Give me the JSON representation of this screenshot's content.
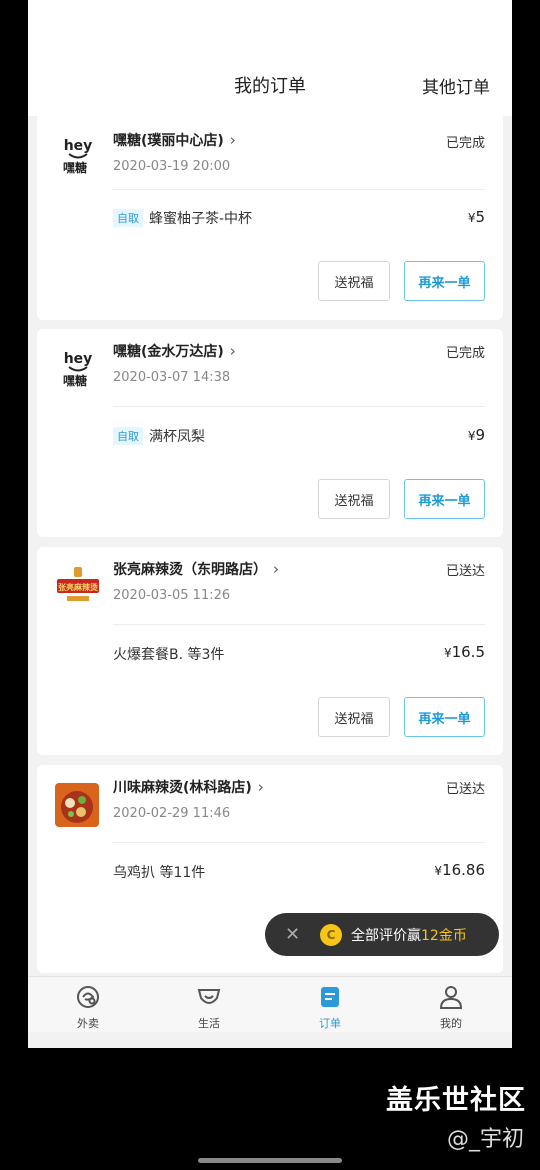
{
  "header": {
    "title": "我的订单",
    "other": "其他订单"
  },
  "orders": [
    {
      "store": "嘿糖(璞丽中心店)",
      "status": "已完成",
      "time": "2020-03-19 20:00",
      "tag": "自取",
      "item": "蜂蜜柚子茶-中杯",
      "price": "5",
      "gift_btn": "送祝福",
      "again_btn": "再来一单",
      "logo": "heytang-logo"
    },
    {
      "store": "嘿糖(金水万达店)",
      "status": "已完成",
      "time": "2020-03-07 14:38",
      "tag": "自取",
      "item": "满杯凤梨",
      "price": "9",
      "gift_btn": "送祝福",
      "again_btn": "再来一单",
      "logo": "heytang-logo"
    },
    {
      "store": "张亮麻辣烫（东明路店）",
      "status": "已送达",
      "time": "2020-03-05 11:26",
      "item": "火爆套餐B.  等3件",
      "price": "16.5",
      "gift_btn": "送祝福",
      "again_btn": "再来一单",
      "logo": "zhangliang-logo"
    },
    {
      "store": "川味麻辣烫(林科路店)",
      "status": "已送达",
      "time": "2020-02-29 11:46",
      "item": "乌鸡扒  等11件",
      "price": "16.86",
      "logo": "food-photo"
    }
  ],
  "yen": "¥",
  "chevron": "›",
  "logo_text": {
    "hey": "hey",
    "tang": "嘿糖",
    "zl": "张亮麻辣烫"
  },
  "toast": {
    "close": "✕",
    "text": "全部评价赢",
    "highlight": "12金币"
  },
  "tabs": [
    {
      "label": "外卖",
      "icon": "takeout-icon"
    },
    {
      "label": "生活",
      "icon": "life-icon"
    },
    {
      "label": "订单",
      "icon": "order-icon",
      "active": true
    },
    {
      "label": "我的",
      "icon": "profile-icon"
    }
  ],
  "watermark": {
    "line1": "盖乐世社区",
    "line2": "@_宇初"
  },
  "colors": {
    "accent": "#2a9bd8",
    "coin": "#f5c518"
  }
}
